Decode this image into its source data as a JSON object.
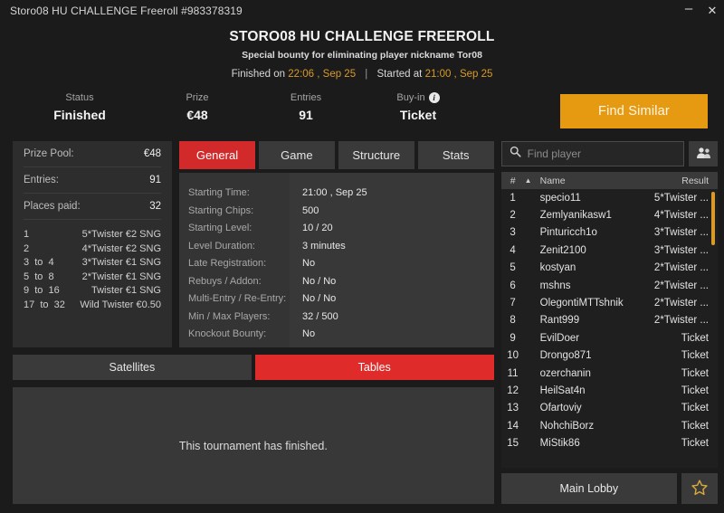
{
  "window": {
    "title": "Storo08 HU CHALLENGE Freeroll #983378319",
    "minimize_label": "–",
    "close_label": "✕"
  },
  "header": {
    "title": "STORO08 HU CHALLENGE FREEROLL",
    "subtitle": "Special bounty for eliminating player nickname Tor08",
    "finished_prefix": "Finished on",
    "finished_value": "22:06 , Sep 25",
    "separator": "|",
    "started_prefix": "Started at",
    "started_value": "21:00 , Sep 25",
    "accent_color": "#d99a28"
  },
  "stats": {
    "status": {
      "label": "Status",
      "value": "Finished"
    },
    "prize": {
      "label": "Prize",
      "value": "€48"
    },
    "entries": {
      "label": "Entries",
      "value": "91"
    },
    "buyin": {
      "label": "Buy-in",
      "value": "Ticket",
      "info_glyph": "i"
    },
    "find_similar_label": "Find Similar",
    "find_similar_color": "#e59a12"
  },
  "prize_panel": {
    "rows": [
      {
        "key": "Prize Pool:",
        "value": "€48"
      },
      {
        "key": "Entries:",
        "value": "91"
      },
      {
        "key": "Places paid:",
        "value": "32"
      }
    ],
    "payouts": [
      {
        "position": "1",
        "prize": "5*Twister €2 SNG"
      },
      {
        "position": "2",
        "prize": "4*Twister €2 SNG"
      },
      {
        "position": "3  to  4",
        "prize": "3*Twister €1 SNG"
      },
      {
        "position": "5  to  8",
        "prize": "2*Twister €1 SNG"
      },
      {
        "position": "9  to  16",
        "prize": "Twister €1 SNG"
      },
      {
        "position": "17  to  32",
        "prize": "Wild Twister €0.50"
      }
    ]
  },
  "tabs": {
    "items": [
      {
        "label": "General",
        "active": true
      },
      {
        "label": "Game",
        "active": false
      },
      {
        "label": "Structure",
        "active": false
      },
      {
        "label": "Stats",
        "active": false
      }
    ],
    "active_color": "#d22a2a"
  },
  "general": {
    "rows": [
      {
        "label": "Starting Time:",
        "value": "21:00 , Sep 25"
      },
      {
        "label": "Starting Chips:",
        "value": "500"
      },
      {
        "label": "Starting Level:",
        "value": "10 / 20"
      },
      {
        "label": "Level Duration:",
        "value": "3 minutes"
      },
      {
        "label": "Late Registration:",
        "value": "No"
      },
      {
        "label": "Rebuys / Addon:",
        "value": "No / No"
      },
      {
        "label": "Multi-Entry / Re-Entry:",
        "value": "No / No"
      },
      {
        "label": "Min / Max Players:",
        "value": "32 / 500"
      },
      {
        "label": "Knockout Bounty:",
        "value": "No"
      }
    ]
  },
  "subtabs": {
    "items": [
      {
        "label": "Satellites",
        "active": false
      },
      {
        "label": "Tables",
        "active": true
      }
    ],
    "active_color": "#e02b2b",
    "empty_message": "This tournament has finished."
  },
  "players": {
    "search_placeholder": "Find player",
    "search_value": "",
    "search_icon": "search-icon",
    "friends_icon": "people-icon",
    "columns": {
      "num": "#",
      "sort_glyph": "▲",
      "name": "Name",
      "result": "Result"
    },
    "rows": [
      {
        "num": "1",
        "name": "specio11",
        "result": "5*Twister ..."
      },
      {
        "num": "2",
        "name": "Zemlyanikasw1",
        "result": "4*Twister ..."
      },
      {
        "num": "3",
        "name": "Pinturicch1o",
        "result": "3*Twister ..."
      },
      {
        "num": "4",
        "name": "Zenit2100",
        "result": "3*Twister ..."
      },
      {
        "num": "5",
        "name": "kostyan",
        "result": "2*Twister ..."
      },
      {
        "num": "6",
        "name": "mshns",
        "result": "2*Twister ..."
      },
      {
        "num": "7",
        "name": "OlegontiMTTshnik",
        "result": "2*Twister ..."
      },
      {
        "num": "8",
        "name": "Rant999",
        "result": "2*Twister ..."
      },
      {
        "num": "9",
        "name": "EvilDoer",
        "result": "Ticket"
      },
      {
        "num": "10",
        "name": "Drongo871",
        "result": "Ticket"
      },
      {
        "num": "11",
        "name": "ozerchanin",
        "result": "Ticket"
      },
      {
        "num": "12",
        "name": "HeilSat4n",
        "result": "Ticket"
      },
      {
        "num": "13",
        "name": "Ofartoviy",
        "result": "Ticket"
      },
      {
        "num": "14",
        "name": "NohchiBorz",
        "result": "Ticket"
      },
      {
        "num": "15",
        "name": "MiStik86",
        "result": "Ticket"
      }
    ],
    "scrollbar": {
      "thumb_top_pct": 1,
      "thumb_height_pct": 19,
      "color": "#d99a28"
    }
  },
  "footer": {
    "main_lobby_label": "Main Lobby",
    "favorite_icon": "star-icon"
  }
}
